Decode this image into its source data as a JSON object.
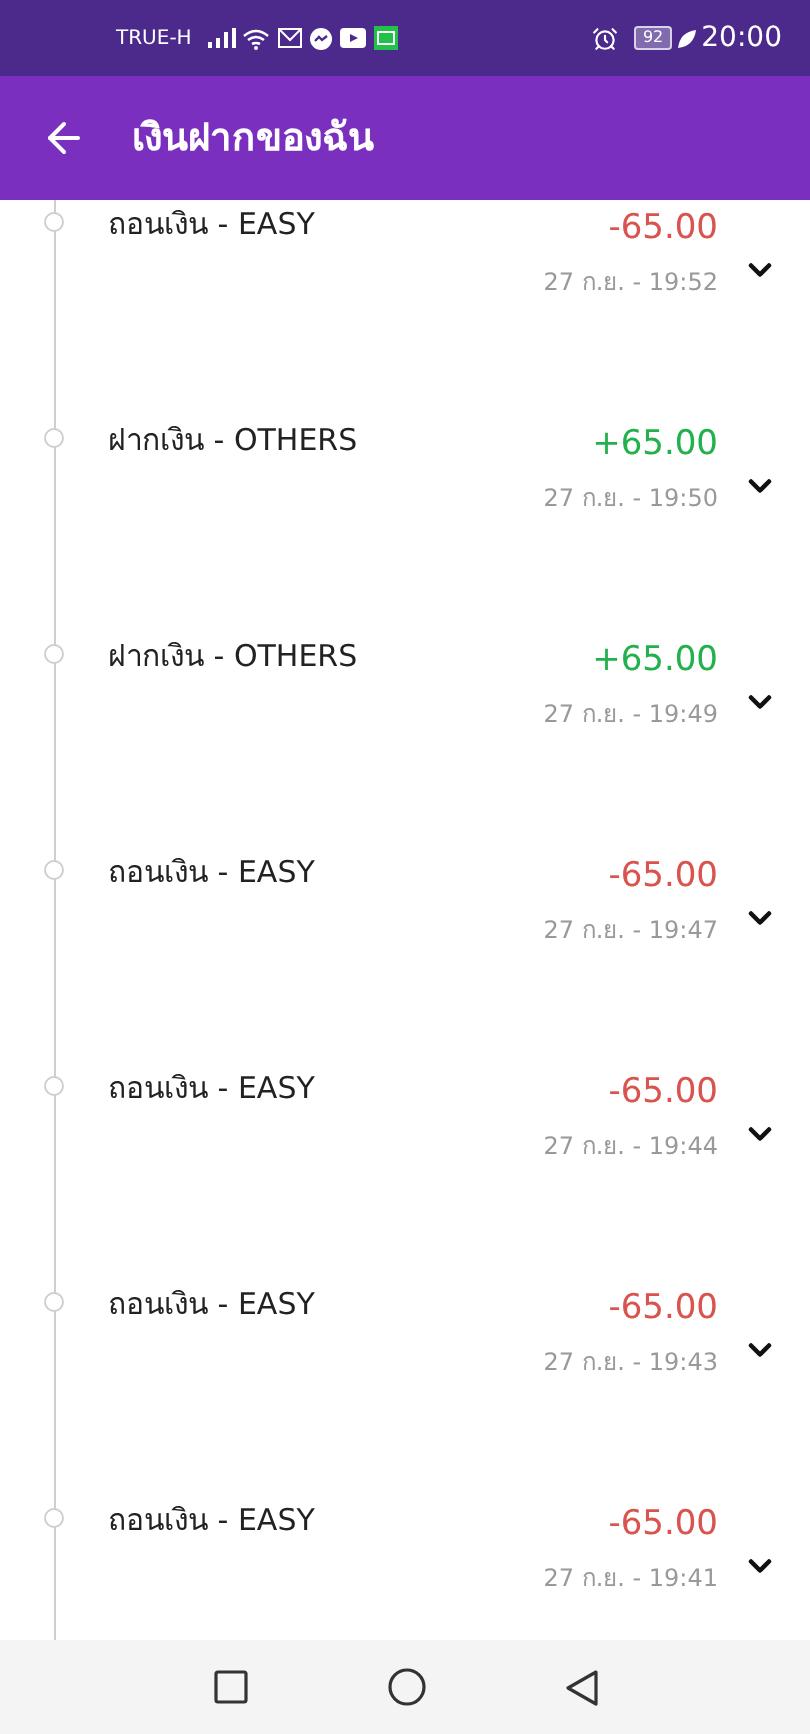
{
  "status_bar": {
    "carrier": "TRUE-H",
    "battery": "92",
    "time": "20:00"
  },
  "header": {
    "title": "เงินฝากของฉัน"
  },
  "transactions": [
    {
      "kind": "withdrawal",
      "title": "ถอนเงิน - EASY",
      "amount": "-65.00",
      "time": "27 ก.ย. - 19:52"
    },
    {
      "kind": "deposit",
      "title": "ฝากเงิน - OTHERS",
      "amount": "+65.00",
      "time": "27 ก.ย. - 19:50"
    },
    {
      "kind": "deposit",
      "title": "ฝากเงิน - OTHERS",
      "amount": "+65.00",
      "time": "27 ก.ย. - 19:49"
    },
    {
      "kind": "withdrawal",
      "title": "ถอนเงิน - EASY",
      "amount": "-65.00",
      "time": "27 ก.ย. - 19:47"
    },
    {
      "kind": "withdrawal",
      "title": "ถอนเงิน - EASY",
      "amount": "-65.00",
      "time": "27 ก.ย. - 19:44"
    },
    {
      "kind": "withdrawal",
      "title": "ถอนเงิน - EASY",
      "amount": "-65.00",
      "time": "27 ก.ย. - 19:43"
    },
    {
      "kind": "withdrawal",
      "title": "ถอนเงิน - EASY",
      "amount": "-65.00",
      "time": "27 ก.ย. - 19:41"
    }
  ]
}
